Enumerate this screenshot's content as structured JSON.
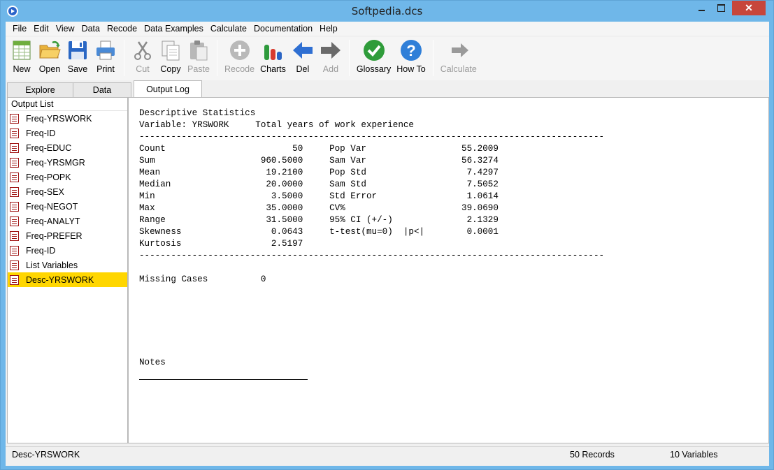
{
  "window": {
    "title": "Softpedia.dcs"
  },
  "menu": [
    "File",
    "Edit",
    "View",
    "Data",
    "Recode",
    "Data Examples",
    "Calculate",
    "Documentation",
    "Help"
  ],
  "toolbar": {
    "new": "New",
    "open": "Open",
    "save": "Save",
    "print": "Print",
    "cut": "Cut",
    "copy": "Copy",
    "paste": "Paste",
    "recode": "Recode",
    "charts": "Charts",
    "del": "Del",
    "add": "Add",
    "glossary": "Glossary",
    "howto": "How To",
    "calculate": "Calculate"
  },
  "tabs": {
    "explore": "Explore",
    "data": "Data",
    "output": "Output Log"
  },
  "output_list": {
    "header": "Output List",
    "items": [
      "Freq-YRSWORK",
      "Freq-ID",
      "Freq-EDUC",
      "Freq-YRSMGR",
      "Freq-POPK",
      "Freq-SEX",
      "Freq-NEGOT",
      "Freq-ANALYT",
      "Freq-PREFER",
      "Freq-ID",
      "List Variables",
      "Desc-YRSWORK"
    ]
  },
  "output_log": {
    "text": "Descriptive Statistics\nVariable: YRSWORK     Total years of work experience\n----------------------------------------------------------------------------------------\nCount                        50     Pop Var                  55.2009\nSum                    960.5000     Sam Var                  56.3274\nMean                    19.2100     Pop Std                   7.4297\nMedian                  20.0000     Sam Std                   7.5052\nMin                      3.5000     Std Error                 1.0614\nMax                     35.0000     CV%                      39.0690\nRange                   31.5000     95% CI (+/-)              2.1329\nSkewness                 0.0643     t-test(mu=0)  |p<|        0.0001\nKurtosis                 2.5197\n----------------------------------------------------------------------------------------\n\nMissing Cases          0",
    "notes_label": "Notes"
  },
  "status": {
    "selected": "Desc-YRSWORK",
    "records": "50 Records",
    "variables": "10 Variables"
  },
  "colors": {
    "titlebar": "#6fb7e9",
    "close": "#c7463b",
    "selected": "#ffd600"
  }
}
